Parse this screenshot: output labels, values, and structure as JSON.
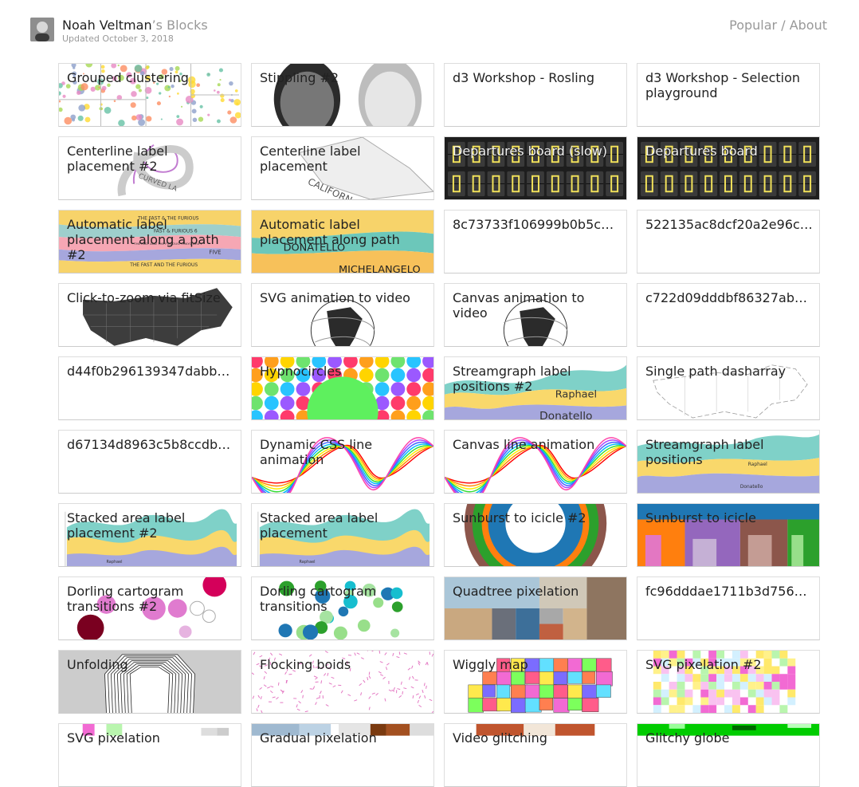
{
  "header": {
    "owner": "Noah Veltman",
    "owner_suffix": "’s Blocks",
    "updated": "Updated October 3, 2018",
    "nav_popular": "Popular",
    "nav_separator": " / ",
    "nav_about": "About"
  },
  "blocks": [
    {
      "title": "Grouped clustering",
      "thumb": "clusters"
    },
    {
      "title": "Stippling #2",
      "thumb": "portrait"
    },
    {
      "title": "d3 Workshop - Rosling",
      "thumb": "blank"
    },
    {
      "title": "d3 Workshop - Selection playground",
      "thumb": "blank"
    },
    {
      "title": "Centerline label placement #2",
      "thumb": "centerline"
    },
    {
      "title": "Centerline label placement",
      "thumb": "centerline2"
    },
    {
      "title": "Departures board (slow)",
      "thumb": "board"
    },
    {
      "title": "Departures board",
      "thumb": "board"
    },
    {
      "title": "Automatic label placement along a path #2",
      "thumb": "bands"
    },
    {
      "title": "Automatic label placement along path",
      "thumb": "waves"
    },
    {
      "title": "8c73733f106999b0b5c6…",
      "thumb": "blank"
    },
    {
      "title": "522135ac8dcf20a2e96c…",
      "thumb": "blank"
    },
    {
      "title": "Click-to-zoom via fitSize",
      "thumb": "usmap"
    },
    {
      "title": "SVG animation to video",
      "thumb": "globe"
    },
    {
      "title": "Canvas animation to video",
      "thumb": "globe"
    },
    {
      "title": "c722d09dddbf86327ab…",
      "thumb": "blank"
    },
    {
      "title": "d44f0b296139347dabb…",
      "thumb": "blank"
    },
    {
      "title": "Hypnocircles",
      "thumb": "hypno"
    },
    {
      "title": "Streamgraph label positions #2",
      "thumb": "stream"
    },
    {
      "title": "Single path dasharray",
      "thumb": "outline"
    },
    {
      "title": "d67134d8963c5b8ccdb…",
      "thumb": "blank"
    },
    {
      "title": "Dynamic CSS line animation",
      "thumb": "sine"
    },
    {
      "title": "Canvas line animation",
      "thumb": "sine"
    },
    {
      "title": "Streamgraph label positions",
      "thumb": "stream2"
    },
    {
      "title": "Stacked area label placement #2",
      "thumb": "stacked"
    },
    {
      "title": "Stacked area label placement",
      "thumb": "stacked"
    },
    {
      "title": "Sunburst to icicle #2",
      "thumb": "sunburst"
    },
    {
      "title": "Sunburst to icicle",
      "thumb": "icicle"
    },
    {
      "title": "Dorling cartogram transitions #2",
      "thumb": "dorling2"
    },
    {
      "title": "Dorling cartogram transitions",
      "thumb": "dorling"
    },
    {
      "title": "Quadtree pixelation",
      "thumb": "pixel"
    },
    {
      "title": "fc96dddae1711b3d756…",
      "thumb": "blank"
    },
    {
      "title": "Unfolding",
      "thumb": "unfold"
    },
    {
      "title": "Flocking boids",
      "thumb": "boids"
    },
    {
      "title": "Wiggly map",
      "thumb": "colormap"
    },
    {
      "title": "SVG pixelation #2",
      "thumb": "pixmap"
    },
    {
      "title": "SVG pixelation",
      "thumb": "pixmap2"
    },
    {
      "title": "Gradual pixelation",
      "thumb": "pixel2"
    },
    {
      "title": "Video glitching",
      "thumb": "video"
    },
    {
      "title": "Glitchy globe",
      "thumb": "glitch"
    }
  ],
  "label_styles": {
    "light": [
      "board"
    ],
    "ellipsis": [
      "8c73733f106999b0b5c6…",
      "522135ac8dcf20a2e96c…",
      "c722d09dddbf86327ab…",
      "d44f0b296139347dabb…",
      "d67134d8963c5b8ccdb…",
      "fc96dddae1711b3d756…"
    ]
  },
  "thumb_text": {
    "centerline": "CURVED LA",
    "centerline2": "CALIFORN",
    "bands": [
      "THE FAST & THE FURIOUS",
      "FAST & FURIOUS 6",
      "THE FAST AND THE FURIOUS: TOKYO DRIFT",
      "FIVE",
      "THE FAST AND THE FURIOUS"
    ],
    "waves": [
      "DONATELLO",
      "MICHELANGELO"
    ],
    "stream": [
      "Raphael",
      "Donatello"
    ],
    "stream2": [
      "Raphael",
      "Donatello"
    ],
    "stacked": [
      "Raphael"
    ]
  },
  "colors": {
    "accent": "#e377c2",
    "board_bg": "#1e1e1e",
    "board_text": "#f2e25a",
    "stream_teal": "#7fd1c8",
    "stream_yellow": "#f9d86b",
    "stream_lavender": "#a6a7dd",
    "stream_pink": "#f6a6b2"
  }
}
